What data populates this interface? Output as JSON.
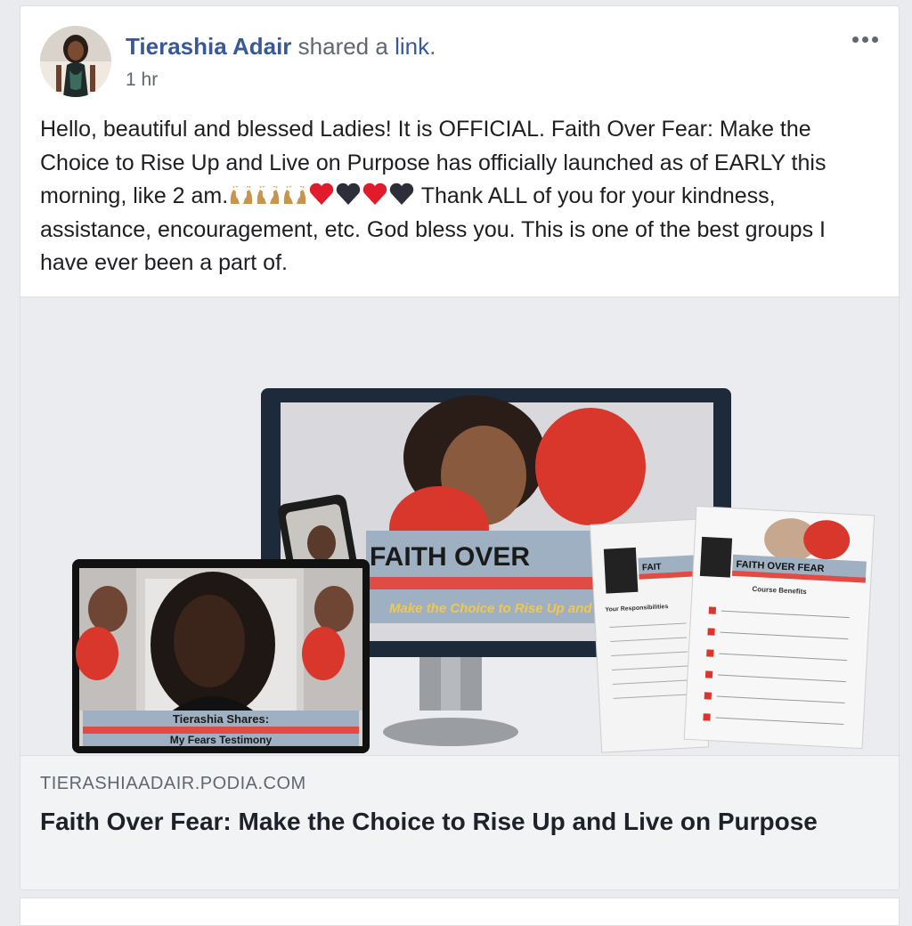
{
  "post": {
    "author": "Tierashia Adair",
    "action_text": " shared a ",
    "action_link": "link",
    "action_end": ".",
    "timestamp": "1 hr",
    "body_line_1": "Hello, beautiful and blessed Ladies! It is OFFICIAL. Faith Over Fear: Make the Choice to Rise Up and Live on Purpose has officially launched as of EARLY this morning, like 2 am.",
    "body_line_2": " Thank ALL of you for your kindness, assistance, encouragement, etc. God bless you. This is one of the best groups I have ever been a part of.",
    "emojis": [
      "raising-hands",
      "raising-hands",
      "raising-hands",
      "red-heart",
      "black-heart",
      "red-heart",
      "black-heart"
    ]
  },
  "link_preview": {
    "domain": "TIERASHIAADAIR.PODIA.COM",
    "title": "Faith Over Fear: Make the Choice to Rise Up and Live on Purpose",
    "image": {
      "monitor_banner": "FAITH OVER",
      "monitor_subtitle": "Make the Choice to Rise Up and L",
      "laptop_caption_line_1": "Tierashia Shares:",
      "laptop_caption_line_2": "My Fears Testimony",
      "sheet_banner": "FAITH OVER FEAR",
      "sheet_heading": "Course Benefits",
      "sheet_small_banner": "FAIT",
      "sheet_small_heading": "Your Responsibilities"
    }
  },
  "colors": {
    "link_blue": "#385898",
    "meta_gray": "#606770",
    "boxing_red": "#d9362c",
    "banner_blue": "#9fb0c3"
  }
}
